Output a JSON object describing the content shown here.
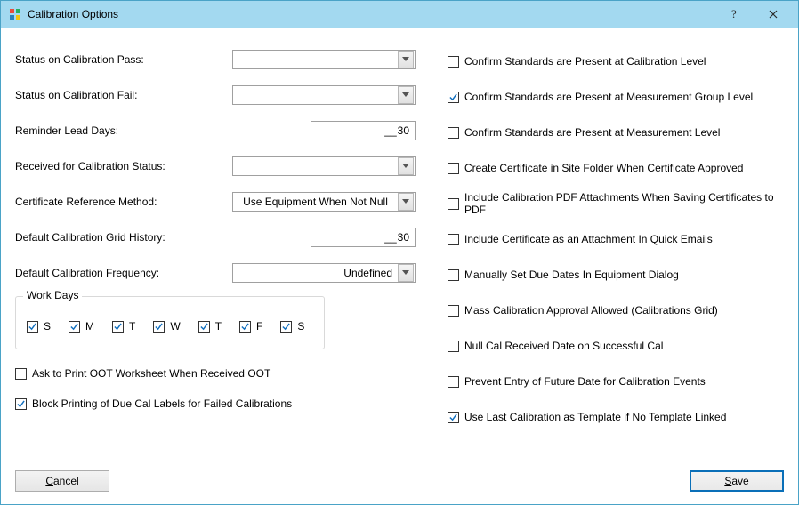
{
  "window": {
    "title": "Calibration Options"
  },
  "left": {
    "status_pass": {
      "label": "Status on Calibration Pass:",
      "value": ""
    },
    "status_fail": {
      "label": "Status on Calibration Fail:",
      "value": ""
    },
    "reminder_lead": {
      "label": "Reminder Lead Days:",
      "value": "30"
    },
    "received_status": {
      "label": "Received for Calibration Status:",
      "value": ""
    },
    "cert_ref_method": {
      "label": "Certificate Reference Method:",
      "value": "Use Equipment When Not Null"
    },
    "grid_history": {
      "label": "Default Calibration Grid History:",
      "value": "30"
    },
    "default_freq": {
      "label": "Default Calibration Frequency:",
      "value": "Undefined"
    },
    "work_days": {
      "legend": "Work Days",
      "items": [
        {
          "label": "S",
          "checked": true
        },
        {
          "label": "M",
          "checked": true
        },
        {
          "label": "T",
          "checked": true
        },
        {
          "label": "W",
          "checked": true
        },
        {
          "label": "T",
          "checked": true
        },
        {
          "label": "F",
          "checked": true
        },
        {
          "label": "S",
          "checked": true
        }
      ]
    },
    "ask_print_oot": {
      "label": "Ask to Print OOT Worksheet When Received OOT",
      "checked": false
    },
    "block_printing": {
      "label": "Block Printing of Due Cal Labels for Failed Calibrations",
      "checked": true
    }
  },
  "right": {
    "items": [
      {
        "label": "Confirm Standards are Present at Calibration Level",
        "checked": false
      },
      {
        "label": "Confirm Standards are Present at Measurement Group Level",
        "checked": true
      },
      {
        "label": "Confirm Standards are Present at Measurement Level",
        "checked": false
      },
      {
        "label": "Create Certificate in Site Folder When Certificate Approved",
        "checked": false
      },
      {
        "label": "Include Calibration PDF Attachments When Saving Certificates to PDF",
        "checked": false
      },
      {
        "label": "Include Certificate as an Attachment In Quick Emails",
        "checked": false
      },
      {
        "label": "Manually Set Due Dates In Equipment Dialog",
        "checked": false
      },
      {
        "label": "Mass Calibration Approval Allowed (Calibrations Grid)",
        "checked": false
      },
      {
        "label": "Null Cal Received Date on Successful Cal",
        "checked": false
      },
      {
        "label": "Prevent Entry of Future Date for Calibration Events",
        "checked": false
      },
      {
        "label": "Use Last Calibration as Template if No Template Linked",
        "checked": true
      }
    ]
  },
  "buttons": {
    "cancel": "Cancel",
    "save": "Save"
  }
}
